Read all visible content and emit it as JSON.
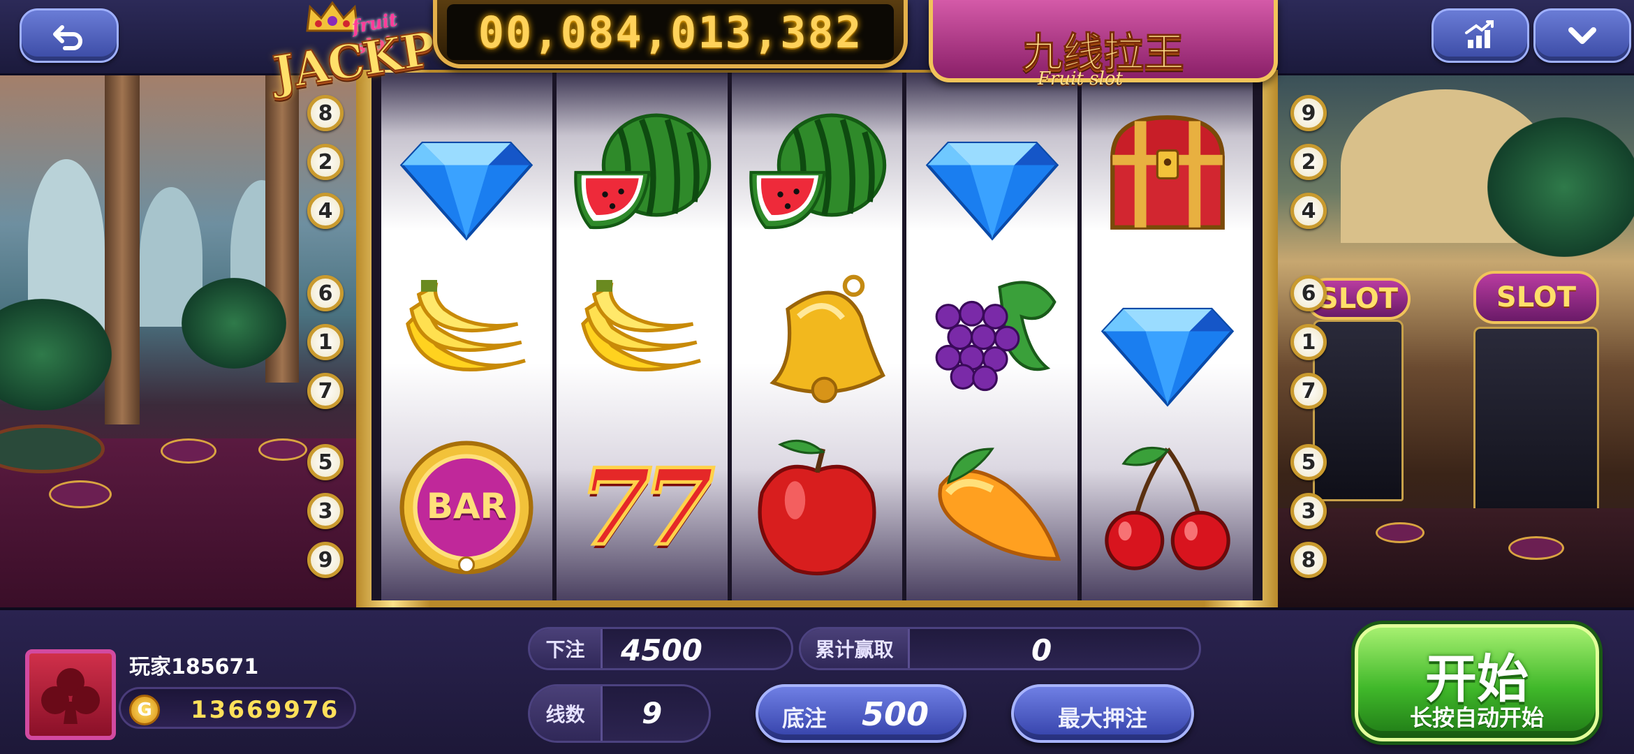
{
  "top_bar": {
    "back_icon": "back-arrow-icon",
    "stats_icon": "stats-chart-icon",
    "collapse_icon": "chevron-down-icon"
  },
  "jackpot": {
    "logo_small": "fruit slot",
    "logo_main": "JACKPOT",
    "amount": "00,084,013,382"
  },
  "game_title": {
    "main": "九线拉王",
    "sub": "Fruit slot"
  },
  "reels": [
    [
      "diamond",
      "banana",
      "bar"
    ],
    [
      "watermelon",
      "banana",
      "seven"
    ],
    [
      "watermelon",
      "bell",
      "apple"
    ],
    [
      "diamond",
      "grape",
      "mango"
    ],
    [
      "treasure-chest",
      "diamond",
      "cherry"
    ]
  ],
  "symbol_text": {
    "bar": "BAR",
    "seven": "77"
  },
  "line_markers": {
    "left": [
      "8",
      "2",
      "4",
      "6",
      "1",
      "7",
      "5",
      "3",
      "9"
    ],
    "right": [
      "9",
      "2",
      "4",
      "6",
      "1",
      "7",
      "5",
      "3",
      "8"
    ]
  },
  "scene": {
    "slot_sign": "SLOT"
  },
  "player": {
    "name": "玩家185671",
    "coin_symbol": "G",
    "coins": "13669976"
  },
  "stats": {
    "bet_label": "下注",
    "bet_value": "4500",
    "winnings_label": "累计赢取",
    "winnings_value": "0",
    "lines_label": "线数",
    "lines_value": "9",
    "base_bet_label": "底注",
    "base_bet_value": "500",
    "max_bet_label": "最大押注"
  },
  "start_button": {
    "label": "开始",
    "sub_label": "长按自动开始"
  },
  "colors": {
    "gold": "#e4b04a",
    "start_green": "#40b82a",
    "button_blue": "#3340a8",
    "plaque_pink": "#d45aa8"
  }
}
